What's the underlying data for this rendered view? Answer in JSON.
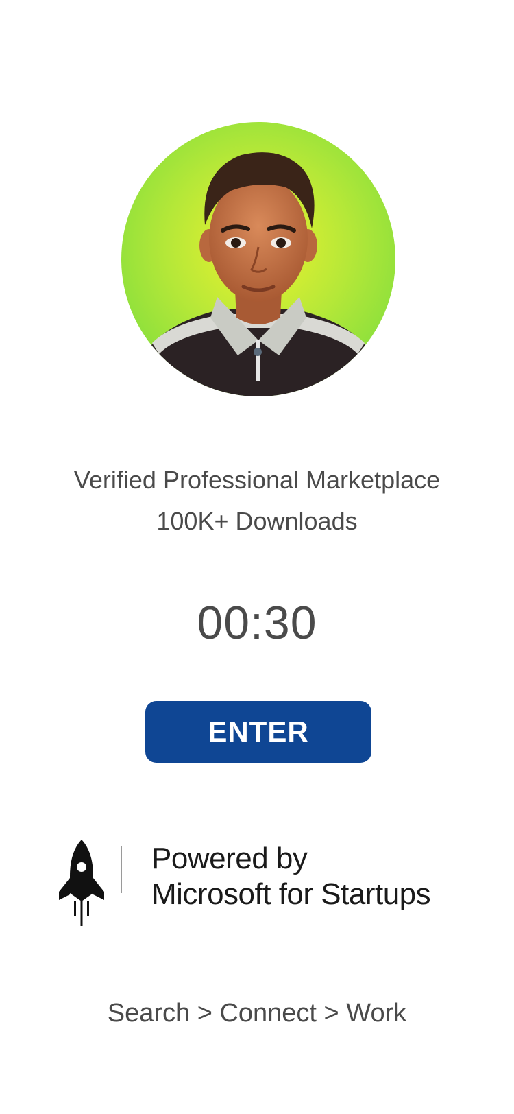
{
  "profile": {
    "avatar_icon": "user-avatar-portrait",
    "background_colors": [
      "#e8f02a",
      "#8fe03c"
    ]
  },
  "tagline": {
    "line1": "Verified Professional Marketplace",
    "line2": "100K+ Downloads"
  },
  "timer": {
    "value": "00:30"
  },
  "actions": {
    "enter_label": "ENTER",
    "enter_color": "#0f4694"
  },
  "brand": {
    "icon": "rocket-icon",
    "line1": "Powered by",
    "line2": "Microsoft for Startups"
  },
  "footer": {
    "slogan": "Search > Connect > Work"
  }
}
